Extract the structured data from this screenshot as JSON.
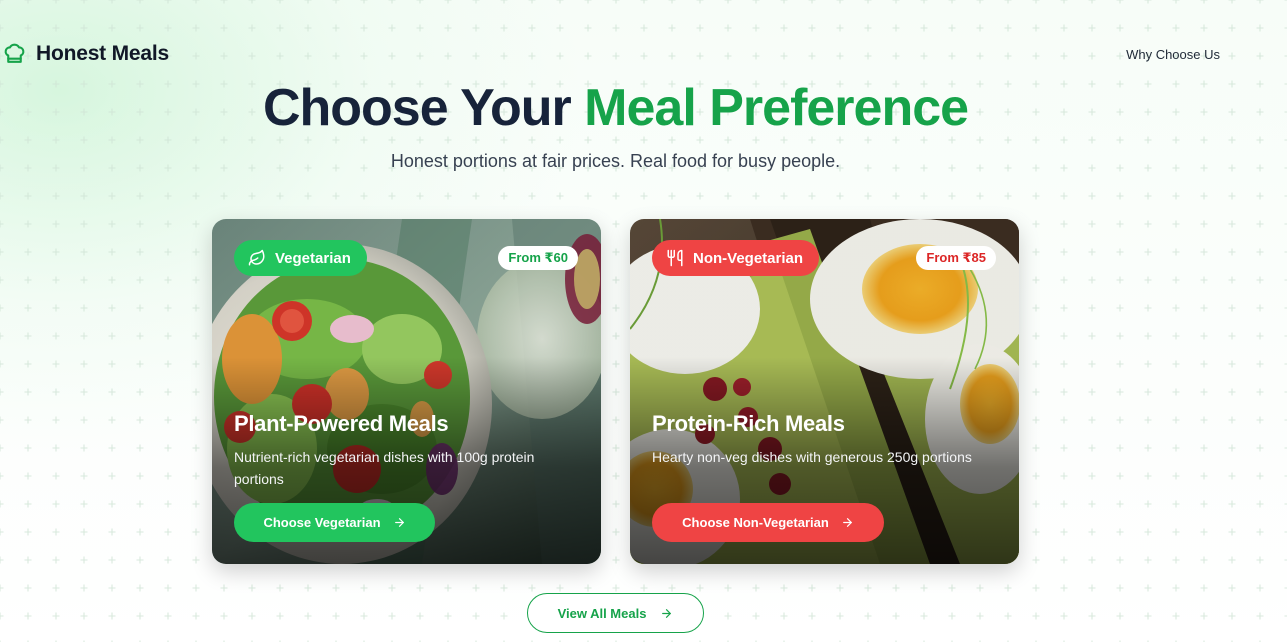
{
  "header": {
    "brand_name": "Honest Meals",
    "logo_icon": "chef-hat-icon",
    "nav_link": "Why Choose Us"
  },
  "hero": {
    "title_main": "Choose Your ",
    "title_accent": "Meal Preference",
    "subtitle": "Honest portions at fair prices. Real food for busy people."
  },
  "cards": {
    "veg": {
      "badge_label": "Vegetarian",
      "badge_icon": "leaf-icon",
      "price": "From ₹60",
      "title": "Plant-Powered Meals",
      "description": "Nutrient-rich vegetarian dishes with 100g protein portions",
      "button_label": "Choose Vegetarian",
      "image": "salad-bowl-photo",
      "accent_color": "#22c55e"
    },
    "nonveg": {
      "badge_label": "Non-Vegetarian",
      "badge_icon": "utensils-icon",
      "price": "From ₹85",
      "title": "Protein-Rich Meals",
      "description": "Hearty non-veg dishes with generous 250g portions",
      "button_label": "Choose Non-Vegetarian",
      "image": "egg-avocado-toast-photo",
      "accent_color": "#ef4444"
    }
  },
  "view_all": {
    "label": "View All Meals",
    "icon": "arrow-right-icon"
  },
  "colors": {
    "brand_green": "#16a34a",
    "title_dark": "#17233a"
  }
}
